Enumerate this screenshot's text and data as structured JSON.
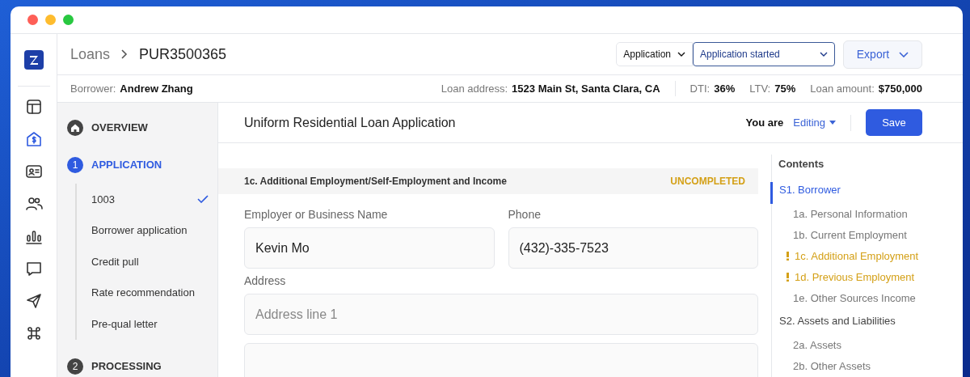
{
  "rail": [
    {
      "kind": "layout",
      "selected": false
    },
    {
      "kind": "house-dollar",
      "selected": true
    },
    {
      "kind": "id-card",
      "selected": false
    },
    {
      "kind": "users",
      "selected": false
    },
    {
      "kind": "bars",
      "selected": false
    },
    {
      "kind": "ai",
      "selected": false
    },
    {
      "kind": "plane",
      "selected": false
    },
    {
      "kind": "command",
      "selected": false
    }
  ],
  "breadcrumb": [
    "Loans",
    "PUR3500365"
  ],
  "stage_select": "Application",
  "status_select": "Application started",
  "export_button": "Export",
  "info": [
    {
      "label": "Borrower:",
      "value": "Andrew Zhang"
    },
    {
      "label": "Loan address:",
      "value": "1523 Main St, Santa Clara, CA"
    },
    {
      "label": "DTI:",
      "value": "36%"
    },
    {
      "label": "LTV:",
      "value": "75%"
    },
    {
      "label": "Loan amount:",
      "value": "$750,000"
    }
  ],
  "nav": [
    {
      "kind": "home",
      "label": "OVERVIEW",
      "selected": false
    },
    {
      "kind": "step",
      "number": "1",
      "label": "APPLICATION",
      "selected": true,
      "children": [
        {
          "label": "1003",
          "checked": true
        },
        {
          "label": "Borrower application",
          "checked": false
        },
        {
          "label": "Credit pull",
          "checked": false
        },
        {
          "label": "Rate recommendation",
          "checked": false
        },
        {
          "label": "Pre-qual letter",
          "checked": false
        }
      ]
    },
    {
      "kind": "step",
      "number": "2",
      "label": "PROCESSING",
      "selected": false
    }
  ],
  "form_title": "Uniform Residential Loan Application",
  "mode_label": "You are",
  "mode": "Editing",
  "save_button": "Save",
  "section": {
    "title": "1c. Additional Employment/Self-Employment and Income",
    "status": "UNCOMPLETED"
  },
  "fields": [
    {
      "label": "Employer or Business Name",
      "value": "Kevin Mo"
    },
    {
      "label": "Phone",
      "value": "(432)-335-7523"
    },
    {
      "label": "Address",
      "placeholder": "Address line 1",
      "kind": "address"
    }
  ],
  "contents": {
    "title": "Contents",
    "items": [
      {
        "label": "S1. Borrower",
        "selected": true,
        "children": [
          {
            "label": "1a. Personal Information",
            "warning": false
          },
          {
            "label": "1b. Current Employment",
            "warning": false
          },
          {
            "label": "1c. Additional Employment",
            "warning": true
          },
          {
            "label": "1d. Previous Employment",
            "warning": true
          },
          {
            "label": "1e. Other Sources Income",
            "warning": false
          }
        ]
      },
      {
        "label": "S2. Assets and Liabilities",
        "selected": false,
        "children": [
          {
            "label": "2a. Assets",
            "warning": false
          },
          {
            "label": "2b. Other Assets",
            "warning": false
          }
        ]
      }
    ]
  }
}
